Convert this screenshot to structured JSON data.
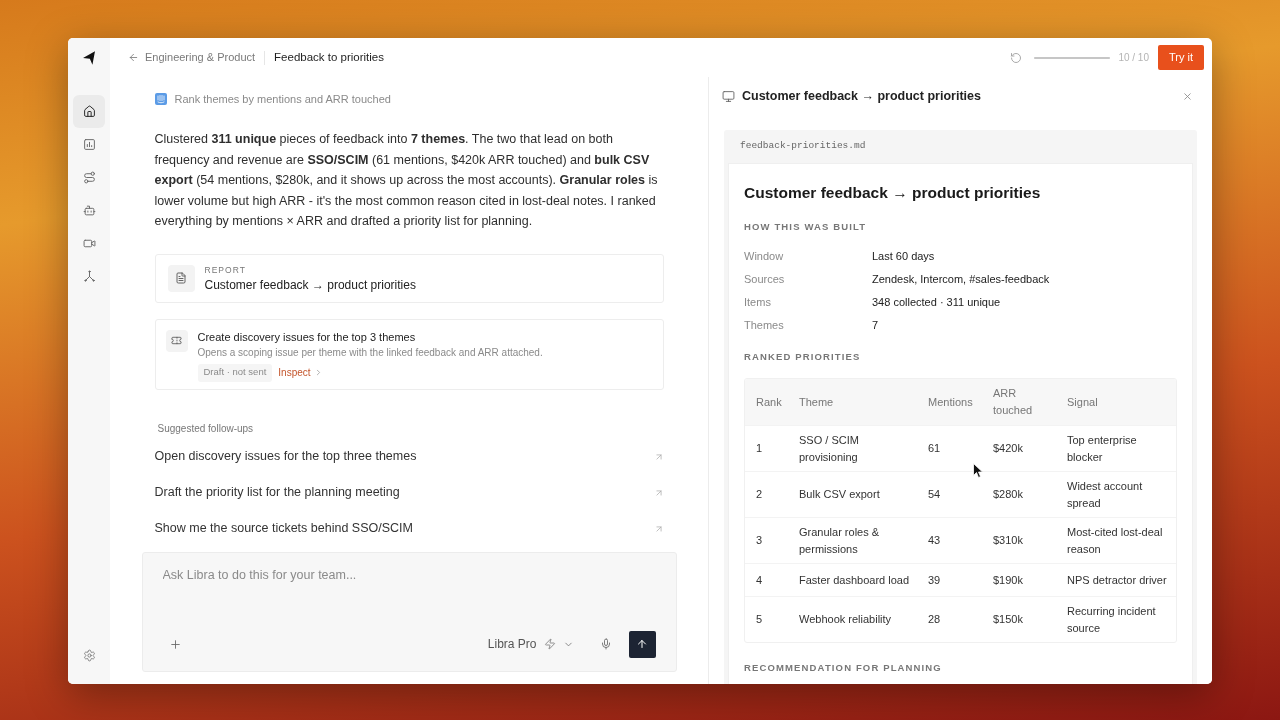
{
  "sidebar": {
    "items": [
      {
        "selected": true
      },
      {
        "selected": false
      },
      {
        "selected": false
      },
      {
        "selected": false
      },
      {
        "selected": false
      },
      {
        "selected": false
      }
    ]
  },
  "header": {
    "back_label": "Engineering & Product",
    "title": "Feedback to priorities",
    "progress": {
      "level": 1,
      "reading": "10 / 10"
    },
    "try_button": "Try it"
  },
  "chat": {
    "task": "Rank themes by mentions and ARR touched",
    "summary": "Clustered **311 unique** pieces of feedback into **7 themes**. The two that lead on both frequency and revenue are **SSO/SCIM** (61 mentions, $420k ARR touched) and **bulk CSV export** (54 mentions, $280k, and it shows up across the most accounts). **Granular roles** is lower volume but high ARR - it's the most common reason cited in lost-deal notes. I ranked everything by mentions × ARR and drafted a priority list for planning.",
    "report_card": {
      "label": "REPORT",
      "title": "Customer feedback → product priorities"
    },
    "action_card": {
      "title": "Create discovery issues for the top 3 themes",
      "description": "Opens a scoping issue per theme with the linked feedback and ARR attached.",
      "status": "Draft · not sent",
      "link": "Inspect"
    },
    "followups": {
      "heading": "Suggested follow-ups",
      "items": [
        "Open discovery issues for the top three themes",
        "Draft the priority list for the planning meeting",
        "Show me the source tickets behind SSO/SCIM"
      ]
    },
    "composer": {
      "placeholder": "Ask Libra to do this for your team...",
      "model": "Libra Pro"
    }
  },
  "panel": {
    "title": "Customer feedback → product priorities",
    "file_name": "feedback-priorities.md",
    "doc": {
      "title": "Customer feedback → product priorities",
      "build": {
        "heading": "HOW THIS WAS BUILT",
        "rows": [
          {
            "label": "Window",
            "value": "Last 60 days"
          },
          {
            "label": "Sources",
            "value": "Zendesk, Intercom, #sales-feedback"
          },
          {
            "label": "Items",
            "value": "348 collected · 311 unique"
          },
          {
            "label": "Themes",
            "value": "7"
          }
        ]
      },
      "ranking": {
        "heading": "RANKED PRIORITIES",
        "columns": [
          "Rank",
          "Theme",
          "Mentions",
          "ARR touched",
          "Signal"
        ],
        "rows": [
          [
            "1",
            "SSO / SCIM provisioning",
            "61",
            "$420k",
            "Top enterprise blocker"
          ],
          [
            "2",
            "Bulk CSV export",
            "54",
            "$280k",
            "Widest account spread"
          ],
          [
            "3",
            "Granular roles & permissions",
            "43",
            "$310k",
            "Most-cited lost-deal reason"
          ],
          [
            "4",
            "Faster dashboard load",
            "39",
            "$190k",
            "NPS detractor driver"
          ],
          [
            "5",
            "Webhook reliability",
            "28",
            "$150k",
            "Recurring incident source"
          ]
        ]
      },
      "next_heading": "RECOMMENDATION FOR PLANNING"
    }
  }
}
